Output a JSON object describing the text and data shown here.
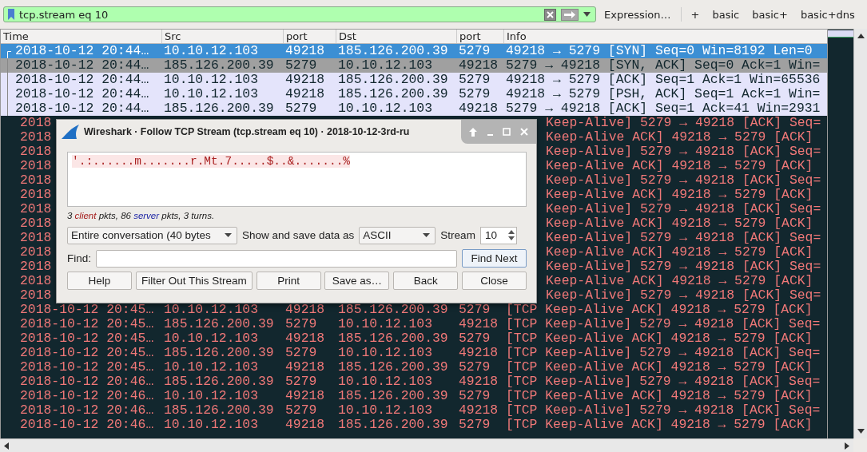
{
  "filter_bar": {
    "value": "tcp.stream eq 10",
    "buttons": [
      "Expression…",
      "+",
      "basic",
      "basic+",
      "basic+dns"
    ]
  },
  "packet_list": {
    "columns": [
      "Time",
      "Src",
      "port",
      "Dst",
      "port",
      "Info"
    ],
    "rows": [
      {
        "kind": "plain",
        "selected": true,
        "related": true,
        "time": "2018-10-12 20:44…",
        "src": "10.10.12.103",
        "sport": "49218",
        "dst": "185.126.200.39",
        "dport": "5279",
        "info": "49218 → 5279 [SYN] Seq=0 Win=8192 Len=0"
      },
      {
        "kind": "dim",
        "selected": false,
        "related": true,
        "time": "2018-10-12 20:44…",
        "src": "185.126.200.39",
        "sport": "5279",
        "dst": "10.10.12.103",
        "dport": "49218",
        "info": "5279 → 49218 [SYN, ACK] Seq=0 Ack=1 Win="
      },
      {
        "kind": "plain",
        "selected": false,
        "related": true,
        "time": "2018-10-12 20:44…",
        "src": "10.10.12.103",
        "sport": "49218",
        "dst": "185.126.200.39",
        "dport": "5279",
        "info": "49218 → 5279 [ACK] Seq=1 Ack=1 Win=65536"
      },
      {
        "kind": "plain",
        "selected": false,
        "related": true,
        "time": "2018-10-12 20:44…",
        "src": "10.10.12.103",
        "sport": "49218",
        "dst": "185.126.200.39",
        "dport": "5279",
        "info": "49218 → 5279 [PSH, ACK] Seq=1 Ack=1 Win="
      },
      {
        "kind": "plain",
        "selected": false,
        "related": true,
        "time": "2018-10-12 20:44…",
        "src": "185.126.200.39",
        "sport": "5279",
        "dst": "10.10.12.103",
        "dport": "49218",
        "info": "5279 → 49218 [ACK] Seq=1 Ack=41 Win=2931"
      },
      {
        "kind": "alert",
        "selected": false,
        "related": false,
        "time": "2018",
        "info": "Keep-Alive] 5279 → 49218 [ACK] Seq="
      },
      {
        "kind": "alert",
        "selected": false,
        "related": false,
        "time": "2018",
        "info": "Keep-Alive ACK] 49218 → 5279 [ACK]"
      },
      {
        "kind": "alert",
        "selected": false,
        "related": false,
        "time": "2018",
        "info": "Keep-Alive] 5279 → 49218 [ACK] Seq="
      },
      {
        "kind": "alert",
        "selected": false,
        "related": false,
        "time": "2018",
        "info": "Keep-Alive ACK] 49218 → 5279 [ACK]"
      },
      {
        "kind": "alert",
        "selected": false,
        "related": false,
        "time": "2018",
        "info": "Keep-Alive] 5279 → 49218 [ACK] Seq="
      },
      {
        "kind": "alert",
        "selected": false,
        "related": false,
        "time": "2018",
        "info": "Keep-Alive ACK] 49218 → 5279 [ACK]"
      },
      {
        "kind": "alert",
        "selected": false,
        "related": false,
        "time": "2018",
        "info": "Keep-Alive] 5279 → 49218 [ACK] Seq="
      },
      {
        "kind": "alert",
        "selected": false,
        "related": false,
        "time": "2018",
        "info": "Keep-Alive ACK] 49218 → 5279 [ACK]"
      },
      {
        "kind": "alert",
        "selected": false,
        "related": false,
        "time": "2018",
        "info": "Keep-Alive] 5279 → 49218 [ACK] Seq="
      },
      {
        "kind": "alert",
        "selected": false,
        "related": false,
        "time": "2018",
        "info": "Keep-Alive ACK] 49218 → 5279 [ACK]"
      },
      {
        "kind": "alert",
        "selected": false,
        "related": false,
        "time": "2018",
        "info": "Keep-Alive] 5279 → 49218 [ACK] Seq="
      },
      {
        "kind": "alert",
        "selected": false,
        "related": false,
        "time": "2018",
        "info": "Keep-Alive ACK] 49218 → 5279 [ACK]"
      },
      {
        "kind": "alert",
        "selected": false,
        "related": false,
        "time": "2018",
        "info": "Keep-Alive] 5279 → 49218 [ACK] Seq="
      },
      {
        "kind": "alert",
        "selected": false,
        "related": false,
        "time": "2018-10-12 20:45…",
        "src": "10.10.12.103",
        "sport": "49218",
        "dst": "185.126.200.39",
        "dport": "5279",
        "info": "[TCP Keep-Alive ACK] 49218 → 5279 [ACK]"
      },
      {
        "kind": "alert",
        "selected": false,
        "related": false,
        "time": "2018-10-12 20:45…",
        "src": "185.126.200.39",
        "sport": "5279",
        "dst": "10.10.12.103",
        "dport": "49218",
        "info": "[TCP Keep-Alive] 5279 → 49218 [ACK] Seq="
      },
      {
        "kind": "alert",
        "selected": false,
        "related": false,
        "time": "2018-10-12 20:45…",
        "src": "10.10.12.103",
        "sport": "49218",
        "dst": "185.126.200.39",
        "dport": "5279",
        "info": "[TCP Keep-Alive ACK] 49218 → 5279 [ACK]"
      },
      {
        "kind": "alert",
        "selected": false,
        "related": false,
        "time": "2018-10-12 20:45…",
        "src": "185.126.200.39",
        "sport": "5279",
        "dst": "10.10.12.103",
        "dport": "49218",
        "info": "[TCP Keep-Alive] 5279 → 49218 [ACK] Seq="
      },
      {
        "kind": "alert",
        "selected": false,
        "related": false,
        "time": "2018-10-12 20:45…",
        "src": "10.10.12.103",
        "sport": "49218",
        "dst": "185.126.200.39",
        "dport": "5279",
        "info": "[TCP Keep-Alive ACK] 49218 → 5279 [ACK]"
      },
      {
        "kind": "alert",
        "selected": false,
        "related": false,
        "time": "2018-10-12 20:46…",
        "src": "185.126.200.39",
        "sport": "5279",
        "dst": "10.10.12.103",
        "dport": "49218",
        "info": "[TCP Keep-Alive] 5279 → 49218 [ACK] Seq="
      },
      {
        "kind": "alert",
        "selected": false,
        "related": false,
        "time": "2018-10-12 20:46…",
        "src": "10.10.12.103",
        "sport": "49218",
        "dst": "185.126.200.39",
        "dport": "5279",
        "info": "[TCP Keep-Alive ACK] 49218 → 5279 [ACK]"
      },
      {
        "kind": "alert",
        "selected": false,
        "related": false,
        "time": "2018-10-12 20:46…",
        "src": "185.126.200.39",
        "sport": "5279",
        "dst": "10.10.12.103",
        "dport": "49218",
        "info": "[TCP Keep-Alive] 5279 → 49218 [ACK] Seq="
      },
      {
        "kind": "alert",
        "selected": false,
        "related": false,
        "time": "2018-10-12 20:46…",
        "src": "10.10.12.103",
        "sport": "49218",
        "dst": "185.126.200.39",
        "dport": "5279",
        "info": "[TCP Keep-Alive ACK] 49218 → 5279 [ACK]"
      }
    ]
  },
  "dialog": {
    "title": "Wireshark · Follow TCP Stream (tcp.stream eq 10) · 2018-10-12-3rd-ru",
    "stream_text": "'.:......m.......r.Mt.7.....$..&.......%",
    "stats": [
      {
        "kind": "plain",
        "text": "3 "
      },
      {
        "kind": "client",
        "text": "client"
      },
      {
        "kind": "plain",
        "text": " pkts, 86 "
      },
      {
        "kind": "server",
        "text": "server"
      },
      {
        "kind": "plain",
        "text": " pkts, 3 turns."
      }
    ],
    "conversation": "Entire conversation (40 bytes",
    "format_label": "Show and save data as",
    "format": "ASCII",
    "stream_label": "Stream",
    "stream": "10",
    "find_label": "Find:",
    "find_next": "Find Next",
    "buttons": [
      "Help",
      "Filter Out This Stream",
      "Print",
      "Save as…",
      "Back",
      "Close"
    ]
  }
}
